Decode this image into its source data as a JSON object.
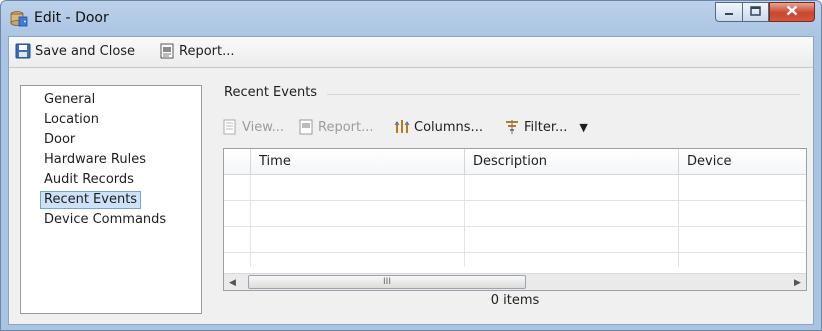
{
  "window": {
    "title": "Edit - Door",
    "icon": "database-door-icon",
    "buttons": {
      "minimize": "minimize-icon",
      "maximize": "maximize-icon",
      "close": "close-icon"
    }
  },
  "toolbar": {
    "save_close_label": "Save and Close",
    "report_label": "Report..."
  },
  "nav": {
    "items": [
      {
        "label": "General"
      },
      {
        "label": "Location"
      },
      {
        "label": "Door"
      },
      {
        "label": "Hardware Rules"
      },
      {
        "label": "Audit Records"
      },
      {
        "label": "Recent Events",
        "selected": true
      },
      {
        "label": "Device Commands"
      }
    ]
  },
  "section": {
    "title": "Recent Events",
    "toolbar": {
      "view_label": "View...",
      "report_label": "Report...",
      "columns_label": "Columns...",
      "filter_label": "Filter...",
      "dropdown_glyph": "▼"
    },
    "grid": {
      "columns": [
        "Time",
        "Description",
        "Device"
      ],
      "rows": [],
      "scroll_grip": "III"
    },
    "status": "0 items"
  },
  "colors": {
    "titlebar": "#b8cfe9",
    "selection": "#cde1f7",
    "close": "#c7462f"
  }
}
